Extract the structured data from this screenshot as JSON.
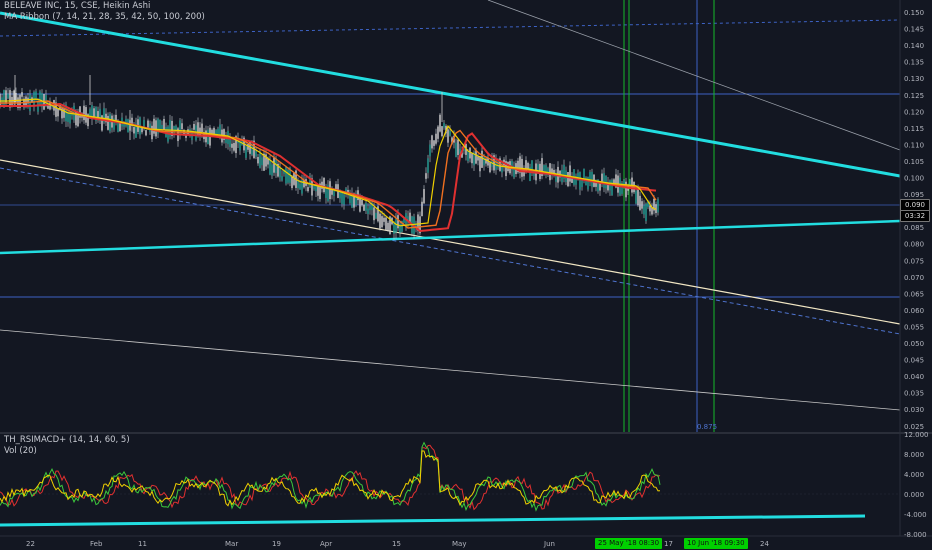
{
  "legend": {
    "symbol_line": "BELEAVE INC, 15, CSE, Heikin Ashi",
    "ribbon_line": "MA Ribbon (7, 14, 21, 28, 35, 42, 50, 100, 200)",
    "osc_line": "TH_RSIMACD+ (14, 14, 60, 5)",
    "vol_line": "Vol (20)"
  },
  "price_axis": {
    "labels": [
      "0.150",
      "0.145",
      "0.140",
      "0.135",
      "0.130",
      "0.125",
      "0.120",
      "0.115",
      "0.110",
      "0.105",
      "0.100",
      "0.095",
      "0.090",
      "0.085",
      "0.080",
      "0.075",
      "0.070",
      "0.065",
      "0.060",
      "0.055",
      "0.050",
      "0.045",
      "0.040",
      "0.035",
      "0.030",
      "0.025"
    ],
    "current_price": "0.090",
    "countdown": "03:32"
  },
  "osc_axis": {
    "labels": [
      "12.000",
      "8.000",
      "4.000",
      "0.000",
      "-4.000",
      "-8.000"
    ]
  },
  "time_axis": {
    "labels": [
      "22",
      "Feb",
      "11",
      "Mar",
      "19",
      "Apr",
      "15",
      "May",
      "Jun",
      "17",
      "24"
    ]
  },
  "fib_label": "0.875",
  "date_markers": [
    "25 May '18  08:30",
    "10 Jun '18  09:30"
  ],
  "colors": {
    "background": "#131722",
    "trend_cyan": "#22dde0",
    "grid_blue": "#3d62c4",
    "vertical_green": "#16b82a",
    "ma_red": "#e03030",
    "ma_yellow": "#f0d000"
  }
}
